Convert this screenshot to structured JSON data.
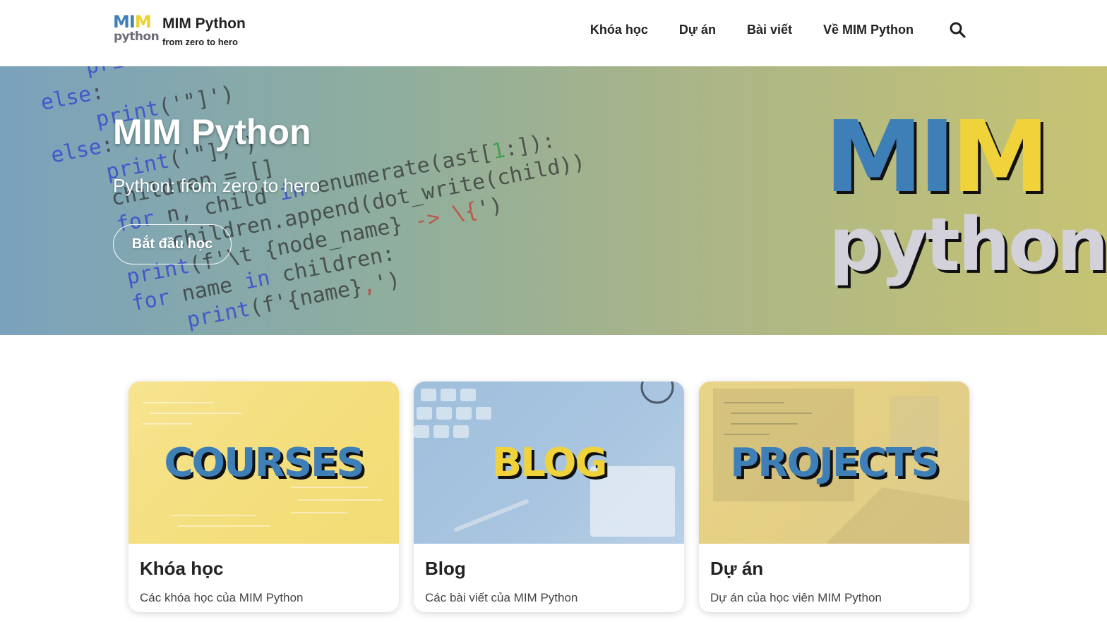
{
  "header": {
    "logo": {
      "mim_blue": "MI",
      "mim_yellow": "M",
      "python": "python"
    },
    "brand_title": "MIM Python",
    "brand_subtitle": "from zero to hero",
    "nav": [
      "Khóa học",
      "Dự án",
      "Bài viết",
      "Về MIM Python"
    ],
    "search_icon": "search-icon"
  },
  "hero": {
    "title": "MIM Python",
    "subtitle": "Python: from zero to hero",
    "button_label": "Bắt đầu học",
    "logo": {
      "mim_blue": "MI",
      "mim_yellow": "M",
      "python": "python"
    }
  },
  "cards": [
    {
      "image_word": "COURSES",
      "title": "Khóa học",
      "description": "Các khóa học của MIM Python"
    },
    {
      "image_word": "BLOG",
      "title": "Blog",
      "description": "Các bài viết của MIM Python"
    },
    {
      "image_word": "PROJECTS",
      "title": "Dự án",
      "description": "Dự án của học viên MIM Python"
    }
  ],
  "colors": {
    "brand_blue": "#3f7fb8",
    "brand_yellow": "#f0d23a",
    "text_dark": "#222222"
  }
}
